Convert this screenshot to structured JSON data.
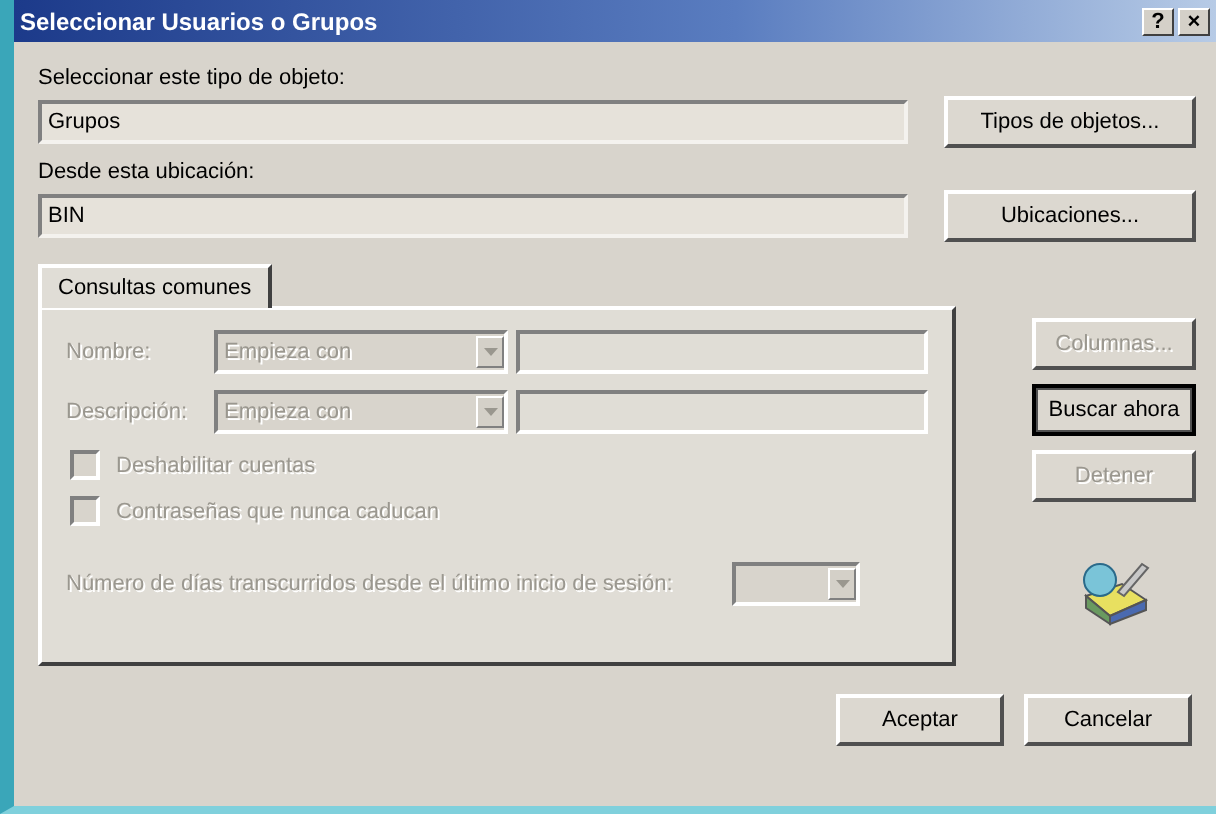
{
  "window": {
    "title": "Seleccionar Usuarios o Grupos",
    "help_button": "?",
    "close_button": "×"
  },
  "object_type": {
    "label": "Seleccionar este tipo de objeto:",
    "value": "Grupos",
    "button": "Tipos de objetos..."
  },
  "location": {
    "label": "Desde esta ubicación:",
    "value": "BIN",
    "button": "Ubicaciones..."
  },
  "tabs": [
    {
      "label": "Consultas comunes",
      "selected": true
    }
  ],
  "query": {
    "disabled": true,
    "rows": [
      {
        "label": "Nombre:",
        "operator": "Empieza con"
      },
      {
        "label": "Descripción:",
        "operator": "Empieza con"
      }
    ],
    "checkboxes": [
      {
        "label": "Deshabilitar cuentas",
        "checked": false
      },
      {
        "label": "Contraseñas que nunca caducan",
        "checked": false
      }
    ],
    "days_label": "Número de días transcurridos desde el último inicio de sesión:"
  },
  "side_buttons": [
    {
      "label": "Columnas...",
      "disabled": true,
      "default": false
    },
    {
      "label": "Buscar ahora",
      "disabled": false,
      "default": true
    },
    {
      "label": "Detener",
      "disabled": true,
      "default": false
    }
  ],
  "buttons": [
    "Aceptar",
    "Cancelar"
  ]
}
